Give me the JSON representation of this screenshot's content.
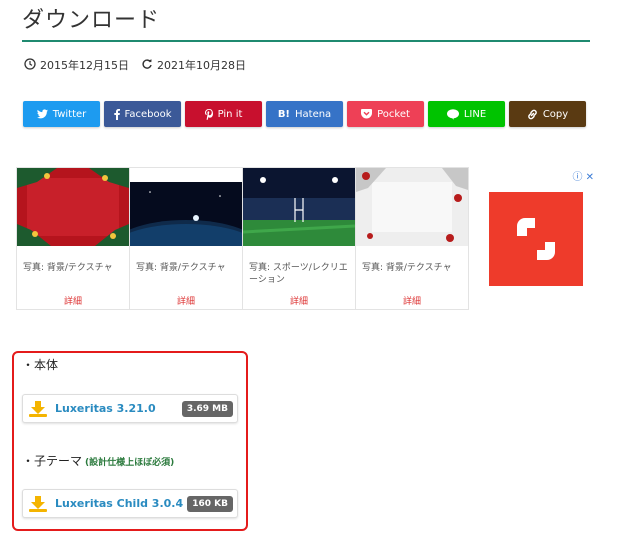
{
  "header": {
    "title": "ダウンロード"
  },
  "dates": {
    "published": "2015年12月15日",
    "updated": "2021年10月28日"
  },
  "share": [
    {
      "label": "Twitter",
      "icon": "twitter-icon",
      "color": "#1d9bf0"
    },
    {
      "label": "Facebook",
      "icon": "facebook-icon",
      "color": "#3b5998"
    },
    {
      "label": "Pin it",
      "icon": "pinterest-icon",
      "color": "#c8102e"
    },
    {
      "label": "Hatena",
      "icon": "hatena-icon",
      "color": "#3673c7",
      "mark": "B!"
    },
    {
      "label": "Pocket",
      "icon": "pocket-icon",
      "color": "#ee4056"
    },
    {
      "label": "LINE",
      "icon": "line-icon",
      "color": "#00c300"
    },
    {
      "label": "Copy",
      "icon": "link-icon",
      "color": "#5a3a12"
    }
  ],
  "ads": {
    "cards": [
      {
        "caption": "写真: 背景/テクスチャ",
        "link": "詳細"
      },
      {
        "caption": "写真: 背景/テクスチャ",
        "link": "詳細"
      },
      {
        "caption": "写真: スポーツ/レクリエーション",
        "link": "詳細"
      },
      {
        "caption": "写真: 背景/テクスチャ",
        "link": "詳細"
      }
    ]
  },
  "downloads": {
    "main_heading": "・本体",
    "main_file": {
      "name": "Luxeritas 3.21.0",
      "size": "3.69 MB"
    },
    "child_heading": "・子テーマ",
    "child_note": "(設計仕様上ほぼ必須)",
    "child_file": {
      "name": "Luxeritas Child 3.0.4",
      "size": "160 KB"
    }
  }
}
